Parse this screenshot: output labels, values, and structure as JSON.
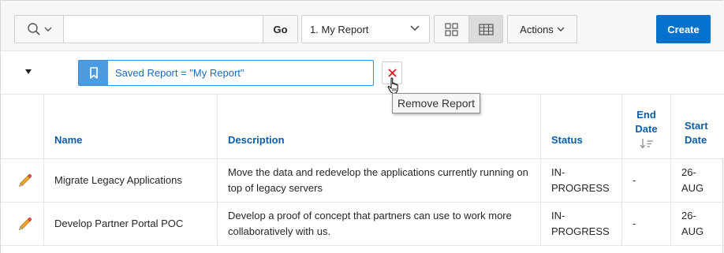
{
  "toolbar": {
    "search_placeholder": "",
    "go_label": "Go",
    "report_select_value": "1. My Report",
    "actions_label": "Actions",
    "create_label": "Create"
  },
  "filter": {
    "chip_text": "Saved Report = \"My Report\"",
    "remove_tooltip": "Remove Report"
  },
  "table": {
    "headers": {
      "name": "Name",
      "description": "Description",
      "status": "Status",
      "end_date_line1": "End",
      "end_date_line2": "Date",
      "start_date_line1": "Start",
      "start_date_line2": "Date"
    },
    "rows": [
      {
        "name": "Migrate Legacy Applications",
        "description": "Move the data and redevelop the applications currently running on top of legacy servers",
        "status_line1": "IN-",
        "status_line2": "PROGRESS",
        "end_date": "-",
        "start_date_line1": "26-",
        "start_date_line2": "AUG"
      },
      {
        "name": "Develop Partner Portal POC",
        "description": "Develop a proof of concept that partners can use to work more collaboratively with us.",
        "status_line1": "IN-",
        "status_line2": "PROGRESS",
        "end_date": "-",
        "start_date_line1": "26-",
        "start_date_line2": "AUG"
      }
    ]
  },
  "colors": {
    "accent": "#0572ce",
    "header_link": "#0a5ea8",
    "chip_border": "#3a8bd6",
    "chip_icon_bg": "#4a9be0",
    "remove_x": "#e0161b",
    "pencil": "#f0a830"
  }
}
